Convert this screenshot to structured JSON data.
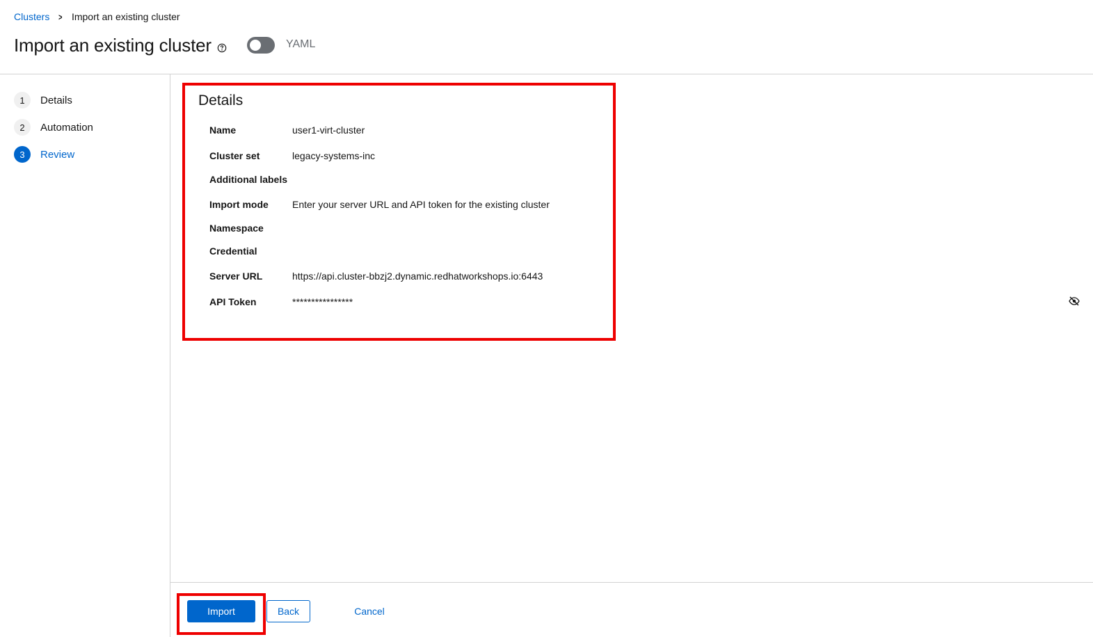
{
  "breadcrumb": {
    "parent": "Clusters",
    "current": "Import an existing cluster"
  },
  "header": {
    "title": "Import an existing cluster",
    "yaml_toggle_label": "YAML",
    "yaml_toggle_on": false
  },
  "wizard": {
    "steps": [
      {
        "number": "1",
        "label": "Details"
      },
      {
        "number": "2",
        "label": "Automation"
      },
      {
        "number": "3",
        "label": "Review"
      }
    ],
    "current_step": "3"
  },
  "review": {
    "section_title": "Details",
    "fields": [
      {
        "term": "Name",
        "value": "user1-virt-cluster"
      },
      {
        "term": "Cluster set",
        "value": "legacy-systems-inc"
      },
      {
        "term": "Additional labels",
        "value": ""
      },
      {
        "term": "Import mode",
        "value": "Enter your server URL and API token for the existing cluster"
      },
      {
        "term": "Namespace",
        "value": ""
      },
      {
        "term": "Credential",
        "value": ""
      },
      {
        "term": "Server URL",
        "value": "https://api.cluster-bbzj2.dynamic.redhatworkshops.io:6443"
      },
      {
        "term": "API Token",
        "value": "****************"
      }
    ]
  },
  "footer": {
    "import_label": "Import",
    "back_label": "Back",
    "cancel_label": "Cancel"
  },
  "colors": {
    "accent": "#0066cc",
    "highlight": "#ee0000"
  },
  "icons": {
    "breadcrumb_separator": "chevron-right-icon",
    "help": "help-circle-icon",
    "token_visibility": "eye-slash-icon"
  }
}
